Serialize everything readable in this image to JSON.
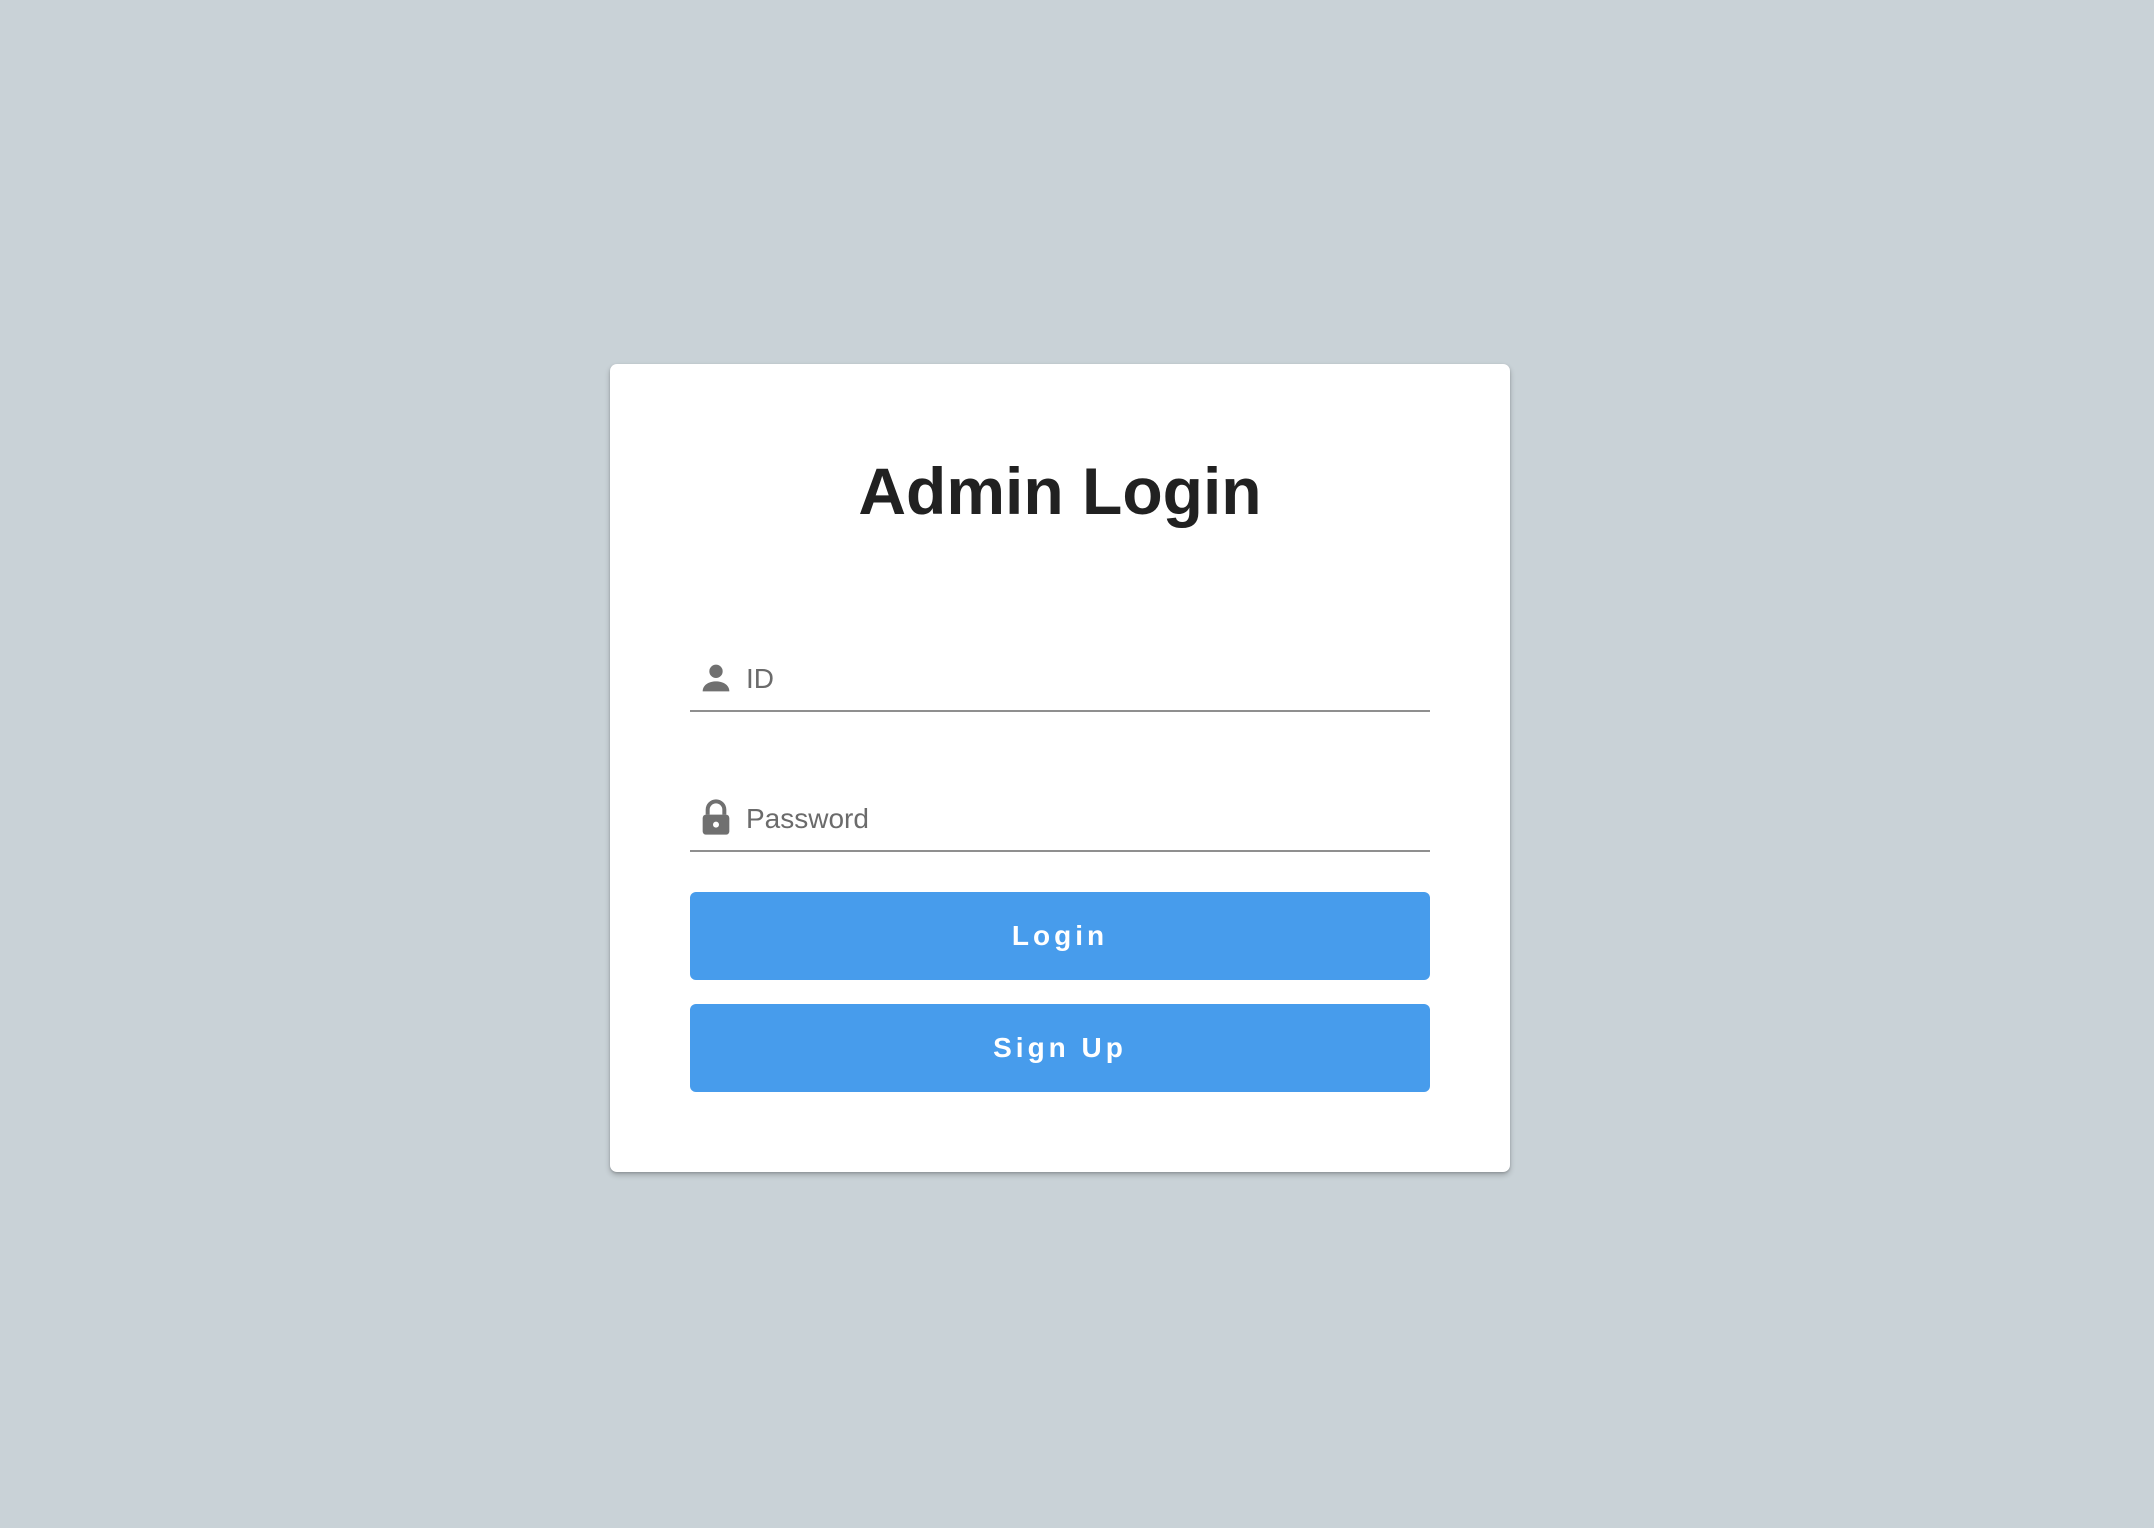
{
  "page": {
    "title": "Admin Login"
  },
  "form": {
    "id_field": {
      "placeholder": "ID",
      "value": "",
      "icon": "person-icon"
    },
    "password_field": {
      "placeholder": "Password",
      "value": "",
      "icon": "lock-icon"
    },
    "login_label": "Login",
    "signup_label": "Sign Up"
  },
  "colors": {
    "background": "#c9d2d7",
    "card": "#ffffff",
    "button": "#479cec",
    "title": "#212121",
    "icon": "#707070"
  }
}
